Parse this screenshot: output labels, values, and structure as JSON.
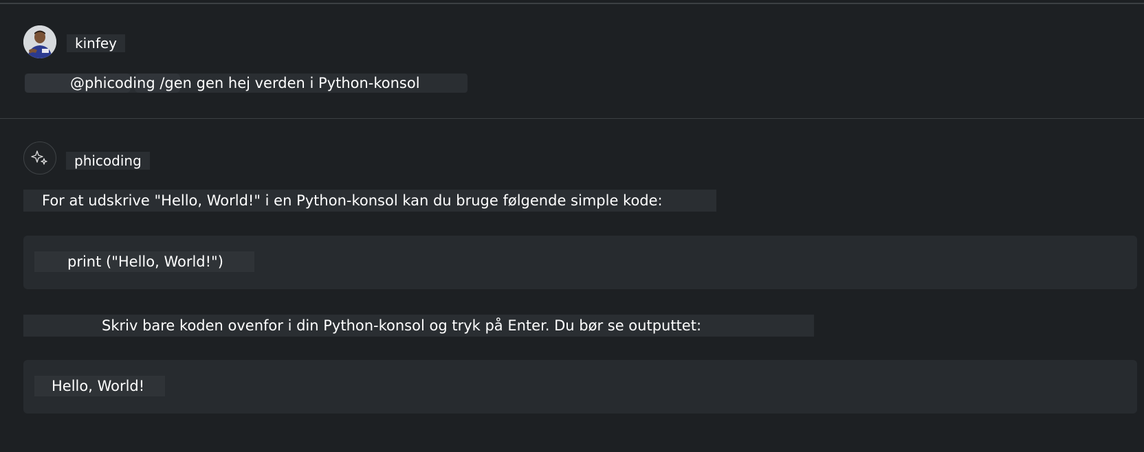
{
  "user_message": {
    "author": "kinfey",
    "avatar_icon": "user-photo-icon",
    "query": "@phicoding /gen gen hej verden i Python-konsol"
  },
  "bot_message": {
    "author": "phicoding",
    "avatar_icon": "sparkle-icon",
    "intro": "For at udskrive \"Hello, World!\" i en Python-konsol kan du bruge følgende simple kode:",
    "code": "print (\"Hello, World!\")",
    "followup": "Skriv bare koden ovenfor i din Python-konsol og tryk på Enter. Du bør se outputtet:",
    "output": "Hello, World!"
  }
}
